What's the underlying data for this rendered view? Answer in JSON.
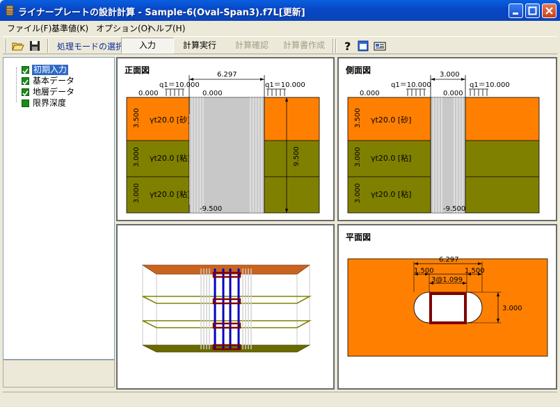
{
  "window": {
    "title": "ライナープレートの設計計算 - Sample-6(Oval-Span3).f7L[更新]"
  },
  "menu": [
    {
      "label": "ファイル(F)"
    },
    {
      "label": "基準値(K)"
    },
    {
      "label": "オプション(O)"
    },
    {
      "label": "ヘルプ(H)"
    }
  ],
  "toolbar": {
    "mode_label": "処理モードの選択",
    "buttons": [
      {
        "label": "入力",
        "state": "pressed"
      },
      {
        "label": "計算実行",
        "state": "enabled"
      },
      {
        "label": "計算確認",
        "state": "disabled"
      },
      {
        "label": "計算書作成",
        "state": "disabled"
      }
    ],
    "icons": [
      "open-folder-icon",
      "save-icon",
      "help-icon",
      "window-icon",
      "id-card-icon"
    ]
  },
  "tree": [
    {
      "label": "初期入力",
      "checked": true,
      "selected": true
    },
    {
      "label": "基本データ",
      "checked": true,
      "selected": false
    },
    {
      "label": "地層データ",
      "checked": true,
      "selected": false
    },
    {
      "label": "限界深度",
      "checked": false,
      "selected": false
    }
  ],
  "front_view": {
    "title": "正面図",
    "width": "6.297",
    "q_left": "q1＝10.000",
    "q_right": "q1＝10.000",
    "level_left": "0.000",
    "level_center": "0.000",
    "depth": "9.500",
    "bottom": "-9.500",
    "layers": [
      {
        "thickness": "3.500",
        "label": "γt20.0 [砂]"
      },
      {
        "thickness": "3.000",
        "label": "γt20.0 [粘]"
      },
      {
        "thickness": "3.000",
        "label": "γt20.0 [粘]"
      }
    ]
  },
  "side_view": {
    "title": "側面図",
    "width": "3.000",
    "q_left": "q1＝10.000",
    "q_right": "q1＝10.000",
    "level_left": "0.000",
    "level_center": "0.000",
    "bottom": "-9.500",
    "layers": [
      {
        "thickness": "3.500",
        "label": "γt20.0 [砂]"
      },
      {
        "thickness": "3.000",
        "label": "γt20.0 [粘]"
      },
      {
        "thickness": "3.000",
        "label": "γt20.0 [粘]"
      }
    ]
  },
  "plan_view": {
    "title": "平面図",
    "total_width": "6.297",
    "left_arc": "1.500",
    "right_arc": "1.500",
    "spans": "3@1.099",
    "height": "3.000"
  },
  "colors": {
    "sand": "#FF8000",
    "clay": "#808000",
    "shaft": "#C8C8C8",
    "frame": "#800000",
    "strut": "#0000C0"
  }
}
